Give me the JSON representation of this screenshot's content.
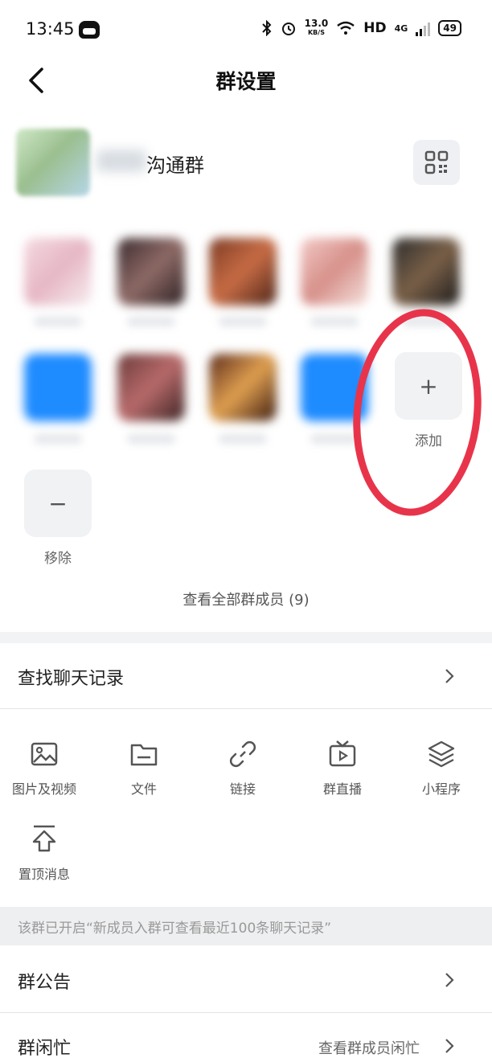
{
  "status_bar": {
    "time": "13:45",
    "net_speed_value": "13.0",
    "net_speed_unit": "KB/S",
    "hd": "HD",
    "network": "4G",
    "battery": "49"
  },
  "header": {
    "title": "群设置"
  },
  "group": {
    "name_suffix": "沟通群"
  },
  "members": {
    "add_label": "添加",
    "add_symbol": "+",
    "remove_label": "移除",
    "remove_symbol": "−",
    "view_all": "查看全部群成员 (9)"
  },
  "search_history": {
    "label": "查找聊天记录"
  },
  "tools": [
    {
      "label": "图片及视频",
      "icon": "image-icon"
    },
    {
      "label": "文件",
      "icon": "folder-icon"
    },
    {
      "label": "链接",
      "icon": "link-icon"
    },
    {
      "label": "群直播",
      "icon": "tv-icon"
    },
    {
      "label": "小程序",
      "icon": "layers-icon"
    },
    {
      "label": "置顶消息",
      "icon": "pin-top-icon"
    }
  ],
  "notice": {
    "text": "该群已开启“新成员入群可查看最近100条聊天记录”"
  },
  "announcement": {
    "label": "群公告"
  },
  "busy": {
    "label": "群闲忙",
    "value": "查看群成员闲忙"
  },
  "colors": {
    "annotation_circle": "#e8344b",
    "blue_avatar": "#1e8bff"
  }
}
